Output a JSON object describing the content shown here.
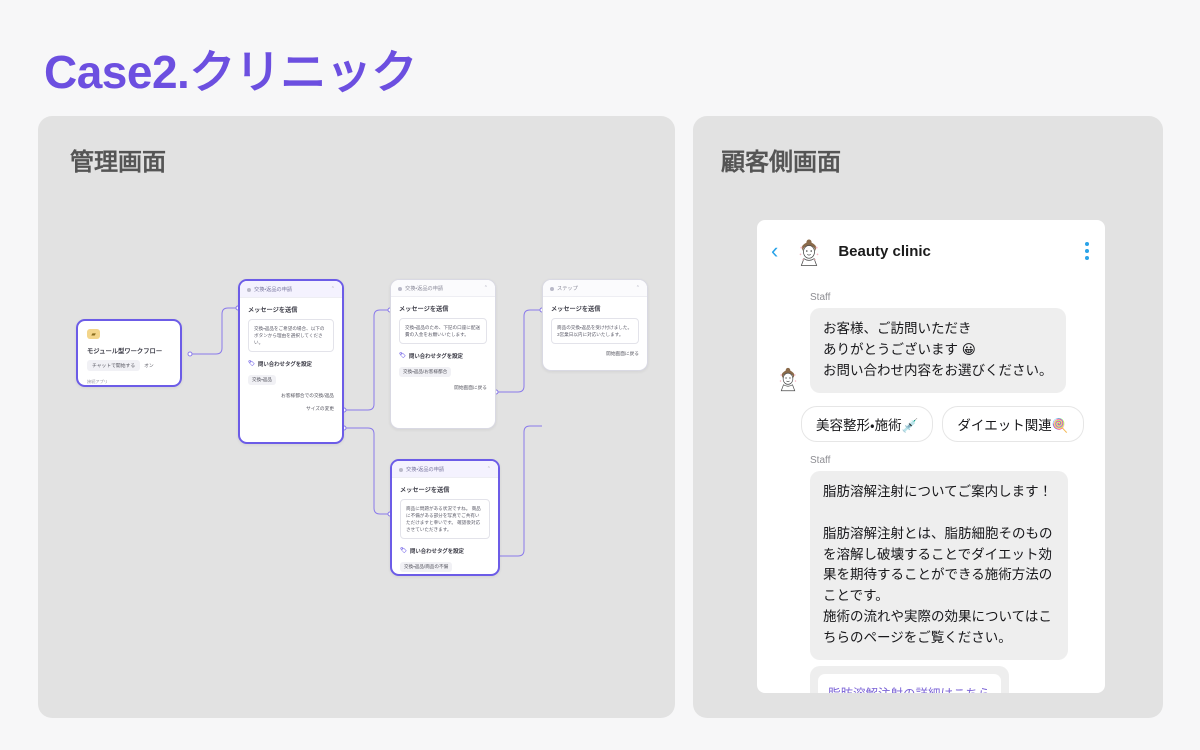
{
  "title": "Case2.クリニック",
  "panels": {
    "left_title": "管理画面",
    "right_title": "顧客側画面"
  },
  "colors": {
    "accent_purple": "#6c4fe0",
    "node_selected_border": "#6c5ce7",
    "link_blue": "#2aa3e8",
    "link_purple": "#7a62d6",
    "panel_bg": "#e2e2e2",
    "page_bg": "#f7f7f8"
  },
  "flow": {
    "start_node": {
      "icon": "wallet-icon",
      "title": "モジュール型ワークフロー",
      "chip": "チャットで開始する",
      "toggle": "オン",
      "sub_label": "接続アプリ"
    },
    "nodes": [
      {
        "id": "node-request",
        "header": "交換・返品の申請",
        "section_label": "メッセージを送信",
        "message": "交換・返品をご希望の場合、以下のボタンから理由を選択してください。",
        "tag_label": "問い合わせタグを設定",
        "tag_value": "交換・返品",
        "links": [
          "お客様都合での交換/返品",
          "サイズの変更"
        ]
      },
      {
        "id": "node-customer-reason",
        "header": "交換・返品の申請",
        "section_label": "メッセージを送信",
        "message": "交換・返品のため、下記の口座に配送費の入金をお願いいたします。",
        "tag_label": "問い合わせタグを設定",
        "tag_value": "交換・返品/お客様都合",
        "links": [
          "開始画面に戻る"
        ]
      },
      {
        "id": "node-step",
        "header": "ステップ",
        "section_label": "メッセージを送信",
        "message": "商品の交換・返品を受け付けました。\n3営業日以内に対応いたします。",
        "tag_label": "",
        "tag_value": "",
        "links": [
          "開始画面に戻る"
        ]
      },
      {
        "id": "node-defect",
        "header": "交換・返品の申請",
        "section_label": "メッセージを送信",
        "message": "商品に問題がある状況ですね。\n商品に不備がある部分を写真でご共有いただけますと幸いです。\n確認後対応させていただきます。",
        "tag_label": "問い合わせタグを設定",
        "tag_value": "交換・返品/商品の不備",
        "links": []
      }
    ]
  },
  "chat": {
    "back_icon": "chevron-left-icon",
    "avatar_icon": "clinic-avatar-icon",
    "clinic_name": "Beauty clinic",
    "menu_icon": "kebab-menu-icon",
    "staff_label": "Staff",
    "message_1": "お客様、ご訪問いただき\nありがとうございます 😀\nお問い合わせ内容をお選びください。",
    "quick_replies": [
      "美容整形・施術💉",
      "ダイエット関連🍭"
    ],
    "staff_label_2": "Staff",
    "message_2": "脂肪溶解注射についてご案内します！\n\n脂肪溶解注射とは、脂肪細胞そのものを溶解し破壊することでダイエット効果を期待することができる施術方法のことです。\n施術の流れや実際の効果についてはこちらのページをご覧ください。",
    "link_button": "脂肪溶解注射の詳細はこちら"
  }
}
